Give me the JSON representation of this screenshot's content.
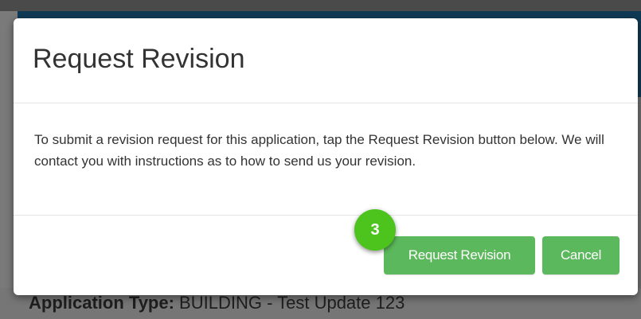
{
  "background": {
    "application_type_label": "Application Type:",
    "application_type_value": " BUILDING - Test Update 123"
  },
  "modal": {
    "title": "Request Revision",
    "body": "To submit a revision request for this application, tap the Request Revision button below. We will contact you with instructions as to how to send us your revision.",
    "buttons": {
      "request_revision": "Request Revision",
      "cancel": "Cancel"
    }
  },
  "step_badge": "3",
  "colors": {
    "primary_button": "#5cb85c",
    "step_badge": "#4dc31e",
    "header_strip": "#0f3a55",
    "overlay": "#6f6f6f"
  }
}
